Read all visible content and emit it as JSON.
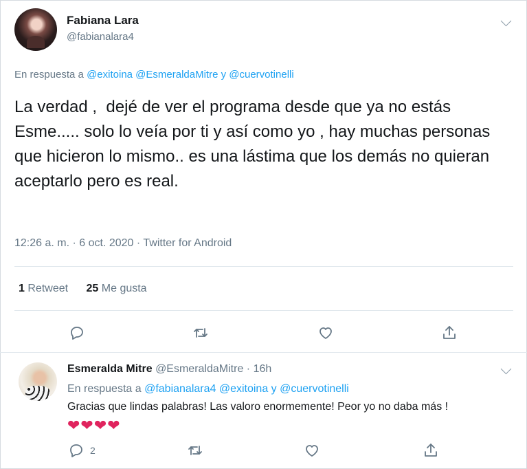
{
  "tweet": {
    "author_name": "Fabiana Lara",
    "author_handle": "@fabianalara4",
    "reply_prefix": "En respuesta a ",
    "reply_mentions": "@exitoina @EsmeraldaMitre y @cuervotinelli",
    "text": "La verdad ,  dejé de ver el programa desde que ya no estás Esme..... solo lo veía por ti y así como yo , hay muchas personas que hicieron lo mismo.. es una lástima que los demás no quieran aceptarlo pero es real.",
    "meta": "12:26 a. m. · 6 oct. 2020 · Twitter for Android",
    "retweets_count": "1",
    "retweets_label": "Retweet",
    "likes_count": "25",
    "likes_label": "Me gusta"
  },
  "reply": {
    "author_name": "Esmeralda Mitre",
    "author_handle": "@EsmeraldaMitre",
    "separator": "·",
    "time": "16h",
    "reply_prefix": "En respuesta a ",
    "reply_mentions": "@fabianalara4 @exitoina y @cuervotinelli",
    "text": "Gracias que lindas palabras! Las valoro enormemente! Peor yo no daba más !",
    "emoji": "❤❤❤❤",
    "reply_count": "2"
  },
  "icons": [
    "chevron-down-icon",
    "reply-icon",
    "retweet-icon",
    "like-icon",
    "share-icon"
  ],
  "colors": {
    "link": "#1da1f2",
    "muted": "#657786",
    "heart": "#e0245e"
  }
}
